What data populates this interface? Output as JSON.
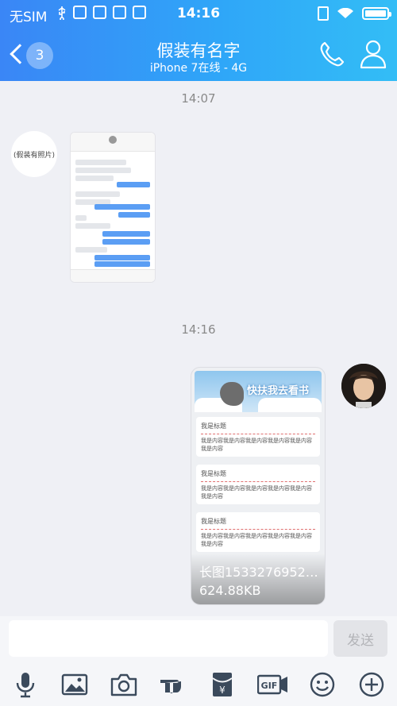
{
  "status_bar": {
    "carrier": "无SIM",
    "time": "14:16",
    "battery_level": 1.0
  },
  "nav": {
    "unread_count": "3",
    "title": "假装有名字",
    "subtitle": "iPhone 7在线 - 4G",
    "icons": [
      "back-chevron-icon",
      "phone-icon",
      "user-profile-icon"
    ]
  },
  "messages": [
    {
      "type": "timestamp",
      "text": "14:07"
    },
    {
      "type": "image",
      "sender": "contact",
      "avatar_text": "(假装有照片)"
    },
    {
      "type": "timestamp",
      "text": "14:16"
    },
    {
      "type": "long_image",
      "sender": "me",
      "banner_title": "快扶我去看书",
      "items": [
        {
          "title": "我是标题",
          "body": "我是内容我是内容我是内容我是内容我是内容我是内容"
        },
        {
          "title": "我是标题",
          "body": "我是内容我是内容我是内容我是内容我是内容我是内容"
        },
        {
          "title": "我是标题",
          "body": "我是内容我是内容我是内容我是内容我是内容我是内容"
        }
      ],
      "file_name": "长图1533276952….",
      "file_size": "624.88KB"
    }
  ],
  "input": {
    "placeholder": "",
    "send_label": "发送"
  },
  "toolbar": [
    "microphone-icon",
    "image-icon",
    "camera-icon",
    "poke-hand-icon",
    "red-packet-icon",
    "gif-icon",
    "emoji-icon",
    "plus-icon"
  ],
  "colors": {
    "header_start": "#3a86f6",
    "header_end": "#33bdf6",
    "background": "#eff0f5",
    "toolbar_icon": "#3b4a5c"
  }
}
